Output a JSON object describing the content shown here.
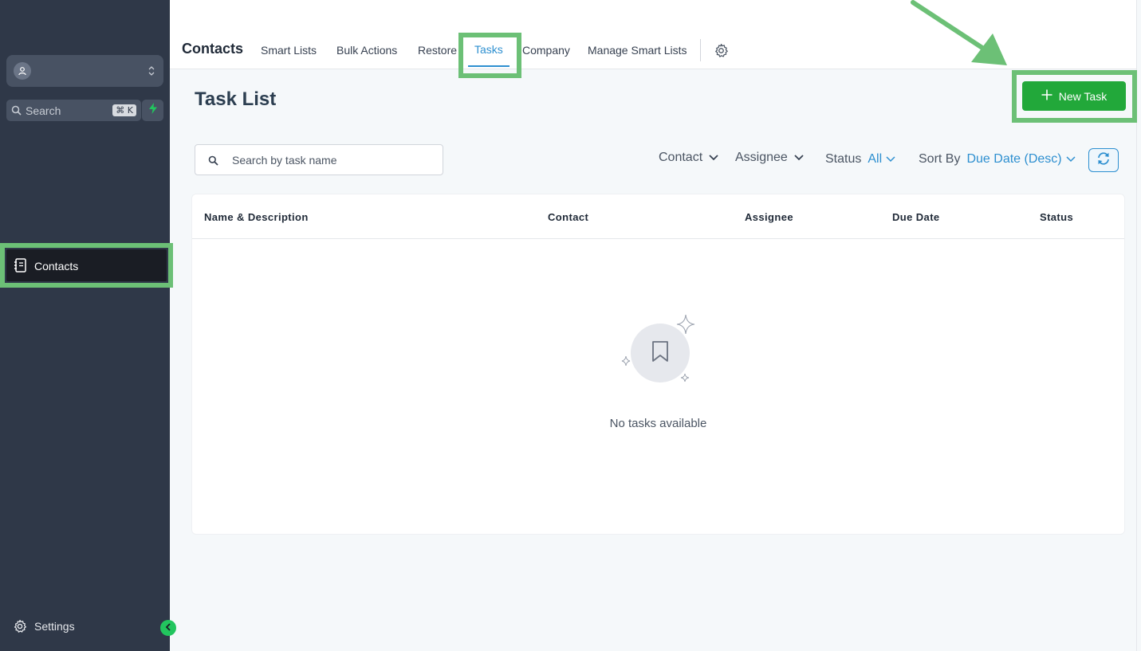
{
  "sidebar": {
    "search_label": "Search",
    "search_shortcut": "⌘ K",
    "nav_items": [
      {
        "label": "Contacts",
        "icon": "contacts-book-icon",
        "active": true
      }
    ],
    "settings_label": "Settings"
  },
  "topbar": {
    "module_title": "Contacts",
    "tabs": [
      {
        "label": "Smart Lists"
      },
      {
        "label": "Bulk Actions"
      },
      {
        "label": "Restore"
      },
      {
        "label": "Tasks",
        "active": true
      },
      {
        "label": "Company"
      },
      {
        "label": "Manage Smart Lists"
      }
    ]
  },
  "page": {
    "title": "Task List",
    "new_task_label": "New Task",
    "search_placeholder": "Search by task name"
  },
  "filters": {
    "contact_label": "Contact",
    "assignee_label": "Assignee",
    "status_label": "Status",
    "status_value": "All",
    "sort_label": "Sort By",
    "sort_value": "Due Date (Desc)"
  },
  "table": {
    "columns": [
      "Name & Description",
      "Contact",
      "Assignee",
      "Due Date",
      "Status"
    ],
    "rows": [],
    "empty_message": "No tasks available"
  },
  "colors": {
    "sidebar_bg": "#2f3848",
    "accent_blue": "#2d8fd0",
    "primary_green": "#22a83a",
    "annotation_green": "#6cc076"
  }
}
